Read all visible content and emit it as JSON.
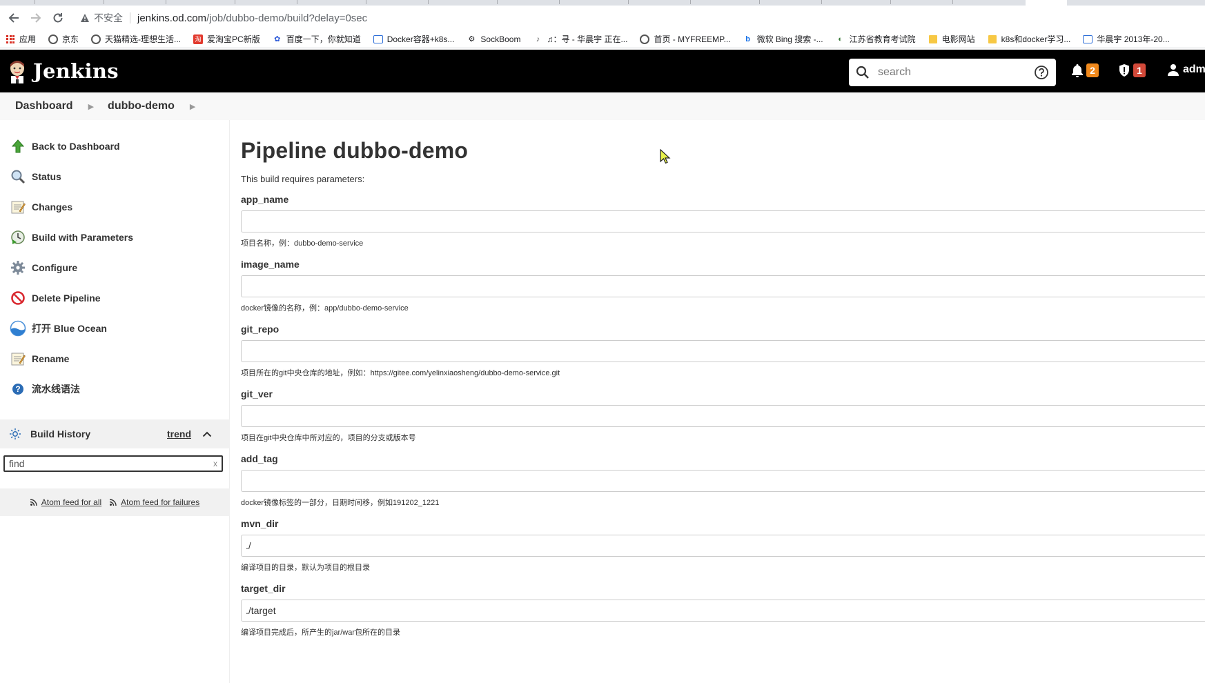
{
  "browser": {
    "insecure_label": "不安全",
    "url_host": "jenkins.od.com",
    "url_path": "/job/dubbo-demo/build?delay=0sec",
    "bookmarks": [
      {
        "label": "应用",
        "icon": "apps-grid-icon"
      },
      {
        "label": "京东",
        "icon": "globe-icon"
      },
      {
        "label": "天猫精选-理想生活...",
        "icon": "globe-icon"
      },
      {
        "label": "爱淘宝PC新版",
        "icon": "red-square-icon"
      },
      {
        "label": "百度一下，你就知道",
        "icon": "baidu-paw-icon"
      },
      {
        "label": "Docker容器+k8s...",
        "icon": "bilibili-tv-icon"
      },
      {
        "label": "SockBoom",
        "icon": "sockboom-icon"
      },
      {
        "label": "♫：寻 - 华晨宇 正在...",
        "icon": "music-icon"
      },
      {
        "label": "首页 - MYFREEMP...",
        "icon": "globe-icon"
      },
      {
        "label": "微软 Bing 搜索 -...",
        "icon": "bing-icon"
      },
      {
        "label": "江苏省教育考试院",
        "icon": "exam-icon"
      },
      {
        "label": "电影网站",
        "icon": "folder-icon"
      },
      {
        "label": "k8s和docker学习...",
        "icon": "folder-icon"
      },
      {
        "label": "华晨宇 2013年-20...",
        "icon": "bilibili-tv-icon"
      }
    ]
  },
  "header": {
    "logo_text": "Jenkins",
    "search_placeholder": "search",
    "notifications_count": "2",
    "security_count": "1",
    "user_name": "adm",
    "notification_color": "#f0891c",
    "security_color": "#d24939"
  },
  "breadcrumb": {
    "items": [
      "Dashboard",
      "dubbo-demo"
    ]
  },
  "sidebar": {
    "tasks": [
      {
        "label": "Back to Dashboard",
        "icon": "up-arrow-icon"
      },
      {
        "label": "Status",
        "icon": "magnifier-icon"
      },
      {
        "label": "Changes",
        "icon": "notepad-icon"
      },
      {
        "label": "Build with Parameters",
        "icon": "clock-play-icon"
      },
      {
        "label": "Configure",
        "icon": "gear-icon"
      },
      {
        "label": "Delete Pipeline",
        "icon": "no-entry-icon"
      },
      {
        "label": "打开 Blue Ocean",
        "icon": "blue-ocean-icon"
      },
      {
        "label": "Rename",
        "icon": "notepad-icon"
      },
      {
        "label": "流水线语法",
        "icon": "help-icon"
      }
    ],
    "build_history": {
      "title": "Build History",
      "trend_label": "trend",
      "find_placeholder": "find",
      "clear_label": "x",
      "feed_all": "Atom feed for all",
      "feed_failures": "Atom feed for failures"
    }
  },
  "main": {
    "title": "Pipeline dubbo-demo",
    "intro": "This build requires parameters:",
    "params": [
      {
        "name": "app_name",
        "value": "",
        "description": "项目名称，例：dubbo-demo-service"
      },
      {
        "name": "image_name",
        "value": "",
        "description": "docker镜像的名称，例：app/dubbo-demo-service"
      },
      {
        "name": "git_repo",
        "value": "",
        "description": "项目所在的git中央仓库的地址，例如：https://gitee.com/yelinxiaosheng/dubbo-demo-service.git"
      },
      {
        "name": "git_ver",
        "value": "",
        "description": "项目在git中央仓库中所对应的，项目的分支或版本号"
      },
      {
        "name": "add_tag",
        "value": "",
        "description": "docker镜像标签的一部分，日期时间移，例如191202_1221"
      },
      {
        "name": "mvn_dir",
        "value": "./",
        "description": "编译项目的目录，默认为项目的根目录"
      },
      {
        "name": "target_dir",
        "value": "./target",
        "description": "编译项目完成后，所产生的jar/war包所在的目录"
      }
    ]
  }
}
